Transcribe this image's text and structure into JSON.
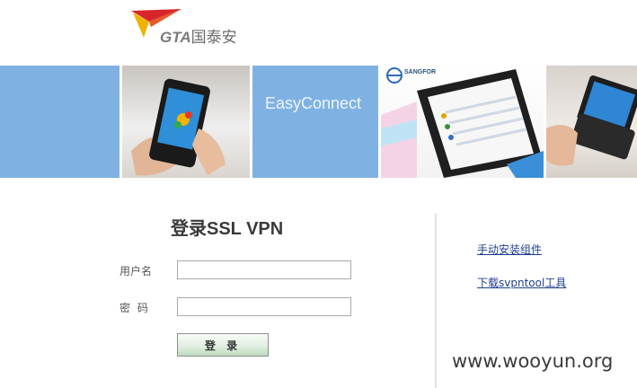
{
  "header": {
    "logo": {
      "latin": "GTA",
      "chinese": "国泰安"
    }
  },
  "banner": {
    "brand_text": "EasyConnect",
    "tablet_brand": "SANGFOR"
  },
  "login": {
    "title": "登录SSL VPN",
    "username_label": "用户名",
    "username_value": "",
    "password_label": "密 码",
    "password_value": "",
    "submit_label": "登 录"
  },
  "links": {
    "manual_install": "手动安装组件",
    "download_tool": "下载svpntool工具"
  },
  "watermark": "www.wooyun.org",
  "colors": {
    "banner_blue": "#7fb2e3",
    "logo_red": "#d7262b",
    "logo_yellow": "#f0b400",
    "link": "#1f3f8f"
  }
}
